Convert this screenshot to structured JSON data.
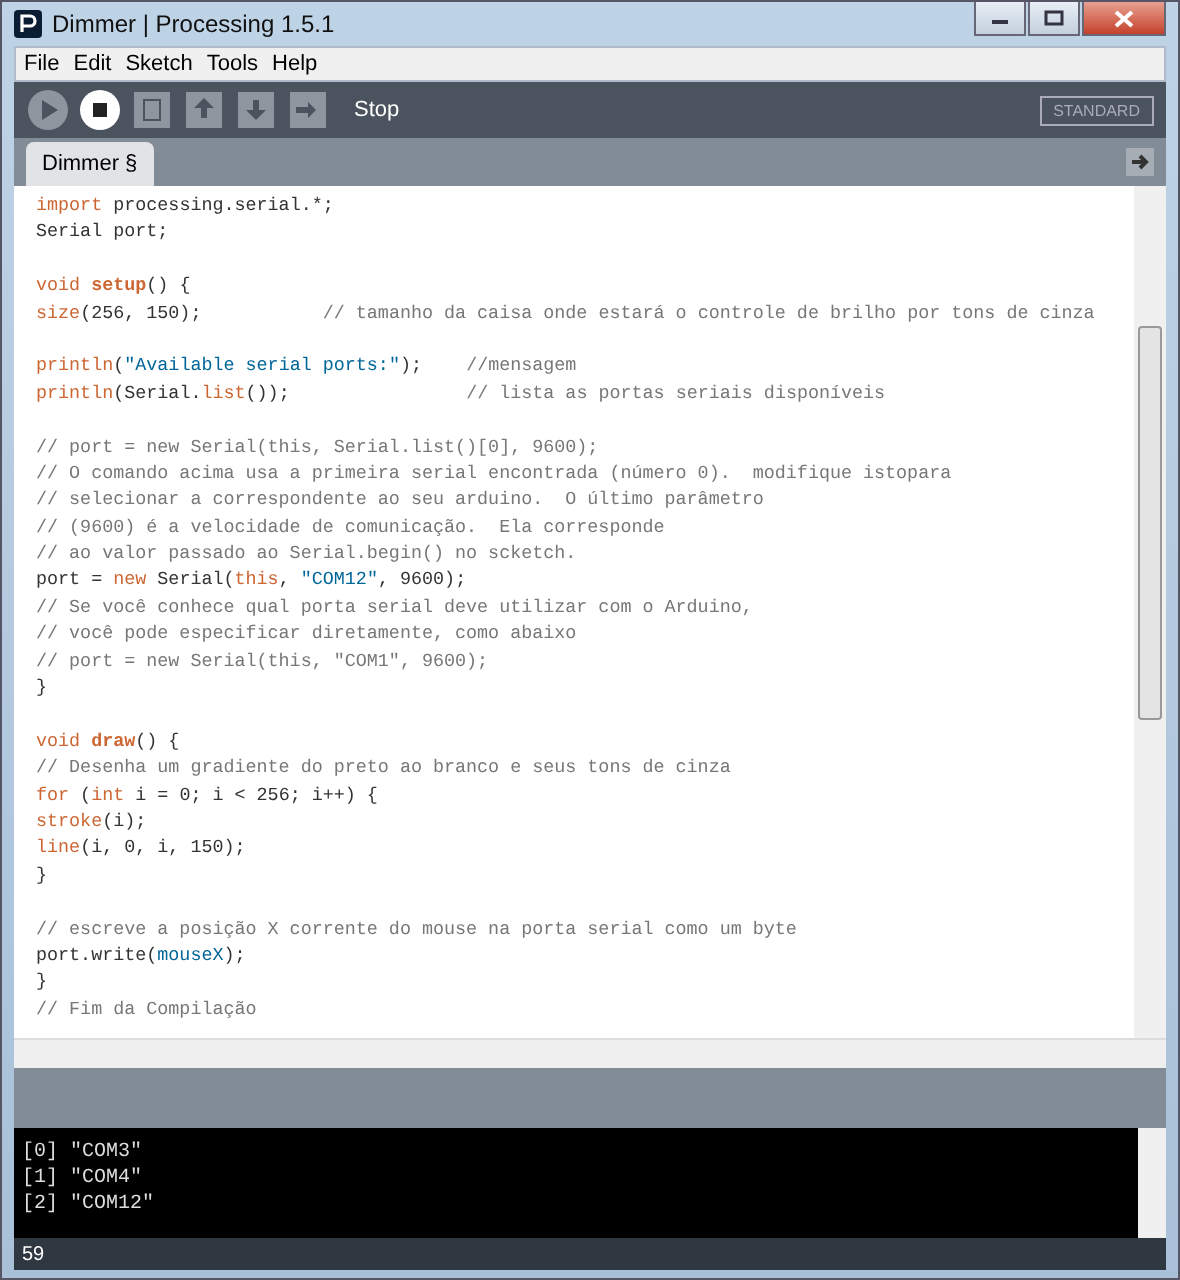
{
  "window": {
    "title": "Dimmer | Processing 1.5.1"
  },
  "menu": [
    "File",
    "Edit",
    "Sketch",
    "Tools",
    "Help"
  ],
  "toolbar": {
    "buttons": [
      {
        "kind": "run",
        "active": false
      },
      {
        "kind": "stop",
        "active": true
      },
      {
        "kind": "new",
        "active": false
      },
      {
        "kind": "open",
        "active": false
      },
      {
        "kind": "save",
        "active": false
      },
      {
        "kind": "export",
        "active": false
      }
    ],
    "status": "Stop",
    "mode": "STANDARD"
  },
  "tabs": [
    {
      "label": "Dimmer §",
      "selected": true
    }
  ],
  "code": [
    {
      "kind": "code",
      "segments": [
        {
          "text": "import",
          "kind": "keyword"
        },
        {
          "text": " processing.serial.*;",
          "kind": "plain"
        }
      ]
    },
    {
      "kind": "code",
      "segments": [
        {
          "text": "Serial port;",
          "kind": "plain"
        }
      ]
    },
    {
      "kind": "blank"
    },
    {
      "kind": "code",
      "segments": [
        {
          "text": "void ",
          "kind": "keyword"
        },
        {
          "text": "setup",
          "kind": "function"
        },
        {
          "text": "() {",
          "kind": "plain"
        }
      ]
    },
    {
      "kind": "code",
      "segments": [
        {
          "text": "size",
          "kind": "keyword"
        },
        {
          "text": "(256, 150);           ",
          "kind": "plain"
        },
        {
          "text": "// tamanho da caisa onde estará o controle de brilho por tons de cinza",
          "kind": "comment"
        }
      ]
    },
    {
      "kind": "blank"
    },
    {
      "kind": "code",
      "segments": [
        {
          "text": "println",
          "kind": "keyword"
        },
        {
          "text": "(",
          "kind": "plain"
        },
        {
          "text": "\"Available serial ports:\"",
          "kind": "string"
        },
        {
          "text": ");    ",
          "kind": "plain"
        },
        {
          "text": "//mensagem",
          "kind": "comment"
        }
      ]
    },
    {
      "kind": "code",
      "segments": [
        {
          "text": "println",
          "kind": "keyword"
        },
        {
          "text": "(Serial.",
          "kind": "plain"
        },
        {
          "text": "list",
          "kind": "keyword"
        },
        {
          "text": "());                ",
          "kind": "plain"
        },
        {
          "text": "// lista as portas seriais disponíveis",
          "kind": "comment"
        }
      ]
    },
    {
      "kind": "blank"
    },
    {
      "kind": "code",
      "segments": [
        {
          "text": "// port = new Serial(this, Serial.list()[0], 9600);",
          "kind": "comment"
        }
      ]
    },
    {
      "kind": "code",
      "segments": [
        {
          "text": "// O comando acima usa a primeira serial encontrada (número 0).  modifique istopara",
          "kind": "comment"
        }
      ]
    },
    {
      "kind": "code",
      "segments": [
        {
          "text": "// selecionar a correspondente ao seu arduino.  O último parâmetro",
          "kind": "comment"
        }
      ]
    },
    {
      "kind": "code",
      "segments": [
        {
          "text": "// (9600) é a velocidade de comunicação.  Ela corresponde",
          "kind": "comment"
        }
      ]
    },
    {
      "kind": "code",
      "segments": [
        {
          "text": "// ao valor passado ao Serial.begin() no scketch.",
          "kind": "comment"
        }
      ]
    },
    {
      "kind": "code",
      "segments": [
        {
          "text": "port = ",
          "kind": "plain"
        },
        {
          "text": "new",
          "kind": "keyword"
        },
        {
          "text": " Serial(",
          "kind": "plain"
        },
        {
          "text": "this",
          "kind": "keyword"
        },
        {
          "text": ", ",
          "kind": "plain"
        },
        {
          "text": "\"COM12\"",
          "kind": "string"
        },
        {
          "text": ", 9600);",
          "kind": "plain"
        }
      ]
    },
    {
      "kind": "code",
      "segments": [
        {
          "text": "// Se você conhece qual porta serial deve utilizar com o Arduino,",
          "kind": "comment"
        }
      ]
    },
    {
      "kind": "code",
      "segments": [
        {
          "text": "// você pode especificar diretamente, como abaixo",
          "kind": "comment"
        }
      ]
    },
    {
      "kind": "code",
      "segments": [
        {
          "text": "// port = new Serial(this, \"COM1\", 9600);",
          "kind": "comment"
        }
      ]
    },
    {
      "kind": "code",
      "segments": [
        {
          "text": "}",
          "kind": "plain"
        }
      ]
    },
    {
      "kind": "blank"
    },
    {
      "kind": "code",
      "segments": [
        {
          "text": "void ",
          "kind": "keyword"
        },
        {
          "text": "draw",
          "kind": "function"
        },
        {
          "text": "() {",
          "kind": "plain"
        }
      ]
    },
    {
      "kind": "code",
      "segments": [
        {
          "text": "// Desenha um gradiente do preto ao branco e seus tons de cinza",
          "kind": "comment"
        }
      ]
    },
    {
      "kind": "code",
      "segments": [
        {
          "text": "for",
          "kind": "keyword"
        },
        {
          "text": " (",
          "kind": "plain"
        },
        {
          "text": "int",
          "kind": "keyword"
        },
        {
          "text": " i = 0; i < 256; i++) {",
          "kind": "plain"
        }
      ]
    },
    {
      "kind": "code",
      "segments": [
        {
          "text": "stroke",
          "kind": "keyword"
        },
        {
          "text": "(i);",
          "kind": "plain"
        }
      ]
    },
    {
      "kind": "code",
      "segments": [
        {
          "text": "line",
          "kind": "keyword"
        },
        {
          "text": "(i, 0, i, 150);",
          "kind": "plain"
        }
      ]
    },
    {
      "kind": "code",
      "segments": [
        {
          "text": "}",
          "kind": "plain"
        }
      ]
    },
    {
      "kind": "blank"
    },
    {
      "kind": "code",
      "segments": [
        {
          "text": "// escreve a posição X corrente do mouse na porta serial como um byte",
          "kind": "comment"
        }
      ]
    },
    {
      "kind": "code",
      "segments": [
        {
          "text": "port.write(",
          "kind": "plain"
        },
        {
          "text": "mouseX",
          "kind": "string"
        },
        {
          "text": ");",
          "kind": "plain"
        }
      ]
    },
    {
      "kind": "code",
      "segments": [
        {
          "text": "}",
          "kind": "plain"
        }
      ]
    },
    {
      "kind": "code",
      "segments": [
        {
          "text": "// Fim da Compilação",
          "kind": "comment"
        }
      ]
    }
  ],
  "console": [
    "[0] \"COM3\"",
    "[1] \"COM4\"",
    "[2] \"COM12\""
  ],
  "status_line": "59"
}
